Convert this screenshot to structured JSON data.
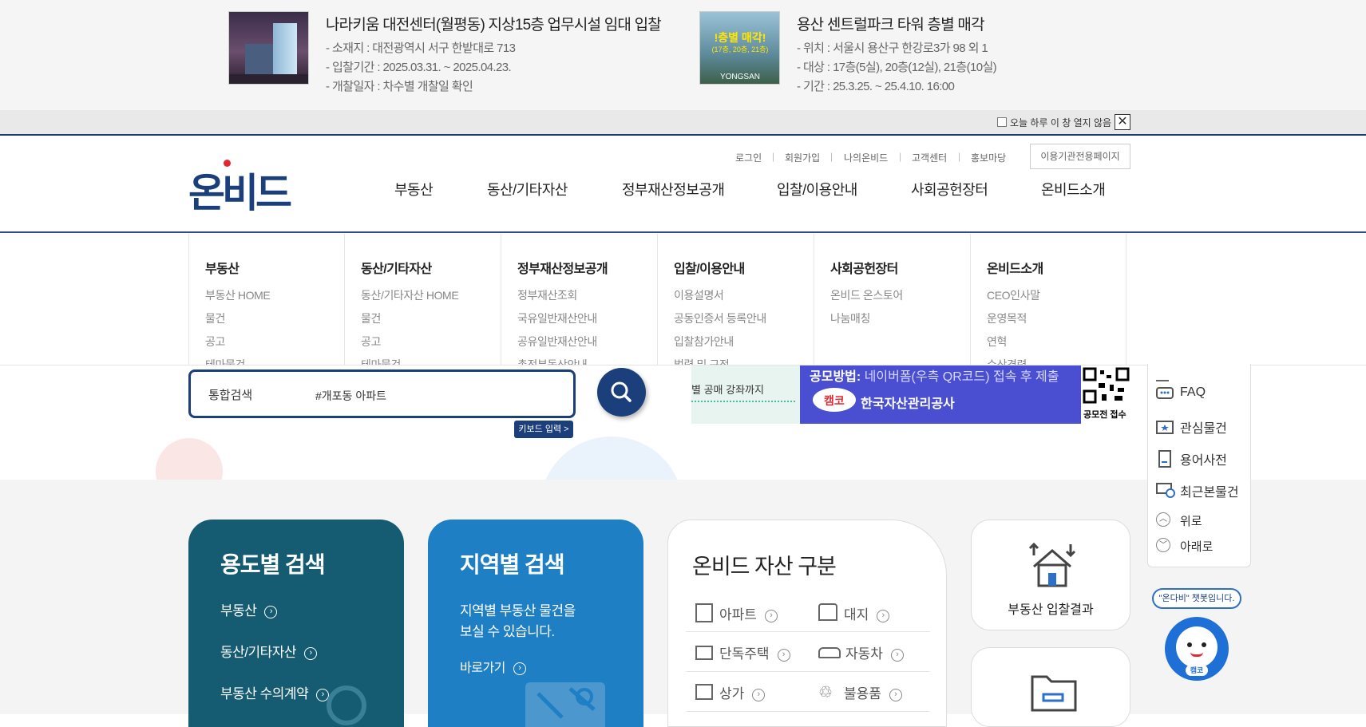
{
  "top_ads": [
    {
      "title": "나라키움 대전센터(월평동) 지상15층 업무시설 임대 입찰",
      "lines": [
        "- 소재지 : 대전광역시 서구 한밭대로 713",
        "- 입찰기간 : 2025.03.31. ~ 2025.04.23.",
        "- 개찰일자 : 차수별 개찰일 확인"
      ]
    },
    {
      "title": "용산 센트럴파크 타워 층별 매각",
      "thumb_text_1": "!층별 매각!",
      "thumb_text_2": "(17층, 20층, 21층)",
      "thumb_text_3": "YONGSAN",
      "lines": [
        "- 위치 : 서울시 용산구 한강로3가 98 외 1",
        "- 대상 : 17층(5실), 20층(12실), 21층(10실)",
        "- 기간 : 25.3.25. ~ 25.4.10. 16:00"
      ]
    }
  ],
  "popup_bar": {
    "checkbox_label": "오늘 하루 이 창 열지 않음",
    "close_label": "✕"
  },
  "header": {
    "logo_text": "온비드",
    "util_links": [
      "로그인",
      "회원가입",
      "나의온비드",
      "고객센터",
      "홍보마당"
    ],
    "inst_button": "이용기관전용페이지",
    "gnb": [
      "부동산",
      "동산/기타자산",
      "정부재산정보공개",
      "입찰/이용안내",
      "사회공헌장터",
      "온비드소개"
    ]
  },
  "mega_menu": [
    {
      "heading": "부동산",
      "items": [
        "부동산 HOME",
        "물건",
        "공고",
        "테마물건"
      ]
    },
    {
      "heading": "동산/기타자산",
      "items": [
        "동산/기타자산 HOME",
        "물건",
        "공고",
        "테마물건"
      ]
    },
    {
      "heading": "정부재산정보공개",
      "items": [
        "정부재산조회",
        "국유일반재산안내",
        "공유일반재산안내",
        "총전부동산안내"
      ]
    },
    {
      "heading": "입찰/이용안내",
      "items": [
        "이용설명서",
        "공동인증서 등록안내",
        "입찰참가안내",
        "법령 및 규정"
      ]
    },
    {
      "heading": "사회공헌장터",
      "items": [
        "온비드 온스토어",
        "나눔매칭"
      ]
    },
    {
      "heading": "온비드소개",
      "items": [
        "CEO인사말",
        "운영목적",
        "연혁",
        "수상경력"
      ]
    }
  ],
  "search": {
    "category": "통합검색",
    "query": "#개포동 아파트",
    "keyboard_label": "키보드 입력 >"
  },
  "banner": {
    "left_text": "별 공매 강좌까지",
    "method_label": "공모방법:",
    "method_text": "네이버폼(우측 QR코드) 접속 후 제출",
    "org_text": "한국자산관리공사",
    "qr_caption": "공모전 접수"
  },
  "cards": {
    "usage": {
      "title": "용도별 검색",
      "items": [
        "부동산",
        "동산/기타자산",
        "부동산 수의계약"
      ]
    },
    "region": {
      "title": "지역별 검색",
      "desc1": "지역별 부동산 물건을",
      "desc2": "보실 수 있습니다.",
      "link": "바로가기"
    },
    "assets": {
      "title": "온비드 자산 구분",
      "items": [
        "아파트",
        "대지",
        "단독주택",
        "자동차",
        "상가",
        "불용품"
      ]
    },
    "result": {
      "label": "부동산 입찰결과"
    }
  },
  "quick_menu": {
    "items": [
      "FAQ",
      "관심물건",
      "용어사전",
      "최근본물건",
      "위로",
      "아래로"
    ]
  },
  "chatbot": {
    "bubble": "\"온다비\" 챗봇입니다.",
    "badge": "캠코"
  }
}
